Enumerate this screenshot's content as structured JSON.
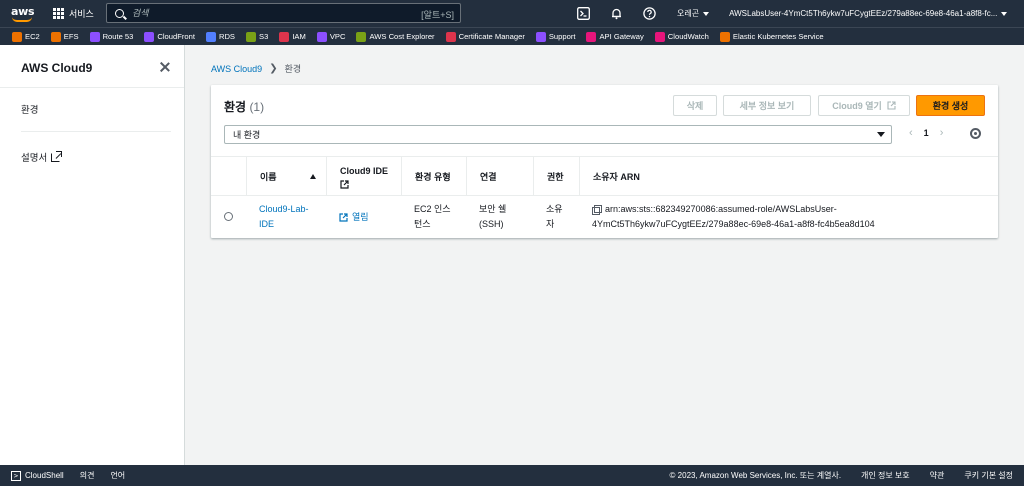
{
  "topnav": {
    "logo_text": "aws",
    "services_label": "서비스",
    "search_placeholder": "검색",
    "search_shortcut": "[알트+S]",
    "region": "오레곤",
    "account": "AWSLabsUser-4YmCt5Th6ykw7uFCygtEEz/279a88ec-69e8-46a1-a8f8-fc..."
  },
  "favorites": [
    {
      "label": "EC2",
      "color": "#ed7100"
    },
    {
      "label": "EFS",
      "color": "#ed7100"
    },
    {
      "label": "Route 53",
      "color": "#8c4fff"
    },
    {
      "label": "CloudFront",
      "color": "#8c4fff"
    },
    {
      "label": "RDS",
      "color": "#527fff"
    },
    {
      "label": "S3",
      "color": "#7aa116"
    },
    {
      "label": "IAM",
      "color": "#dd344c"
    },
    {
      "label": "VPC",
      "color": "#8c4fff"
    },
    {
      "label": "AWS Cost Explorer",
      "color": "#7aa116"
    },
    {
      "label": "Certificate Manager",
      "color": "#dd344c"
    },
    {
      "label": "Support",
      "color": "#8c4fff"
    },
    {
      "label": "API Gateway",
      "color": "#e7157b"
    },
    {
      "label": "CloudWatch",
      "color": "#e7157b"
    },
    {
      "label": "Elastic Kubernetes Service",
      "color": "#ed7100"
    }
  ],
  "sidenav": {
    "title": "AWS Cloud9",
    "items": [
      "환경",
      "설명서"
    ]
  },
  "breadcrumb": {
    "root": "AWS Cloud9",
    "current": "환경"
  },
  "panel": {
    "title": "환경",
    "count": "(1)",
    "buttons": {
      "delete": "삭제",
      "details": "세부 정보 보기",
      "open": "Cloud9 열기",
      "create": "환경 생성"
    },
    "filter_value": "내 환경",
    "page": "1"
  },
  "table": {
    "headers": {
      "name": "이름",
      "ide_line1": "Cloud9 IDE",
      "env_type": "환경 유형",
      "connection": "연결",
      "permission": "권한",
      "owner_arn": "소유자 ARN"
    },
    "rows": [
      {
        "name_line1": "Cloud9-Lab-",
        "name_line2": "IDE",
        "ide": "열림",
        "env_type_line1": "EC2 인스",
        "env_type_line2": "턴스",
        "connection_line1": "보안 쉘",
        "connection_line2": "(SSH)",
        "permission_line1": "소유",
        "permission_line2": "자",
        "arn_line1": "arn:aws:sts::682349270086:assumed-role/AWSLabsUser-",
        "arn_line2": "4YmCt5Th6ykw7uFCygtEEz/279a88ec-69e8-46a1-a8f8-fc4b5ea8d104"
      }
    ]
  },
  "footer": {
    "cloudshell": "CloudShell",
    "feedback": "의견",
    "language": "언어",
    "copyright": "© 2023, Amazon Web Services, Inc. 또는 계열사.",
    "privacy": "개인 정보 보호",
    "terms": "약관",
    "cookies": "쿠키 기본 설정"
  }
}
